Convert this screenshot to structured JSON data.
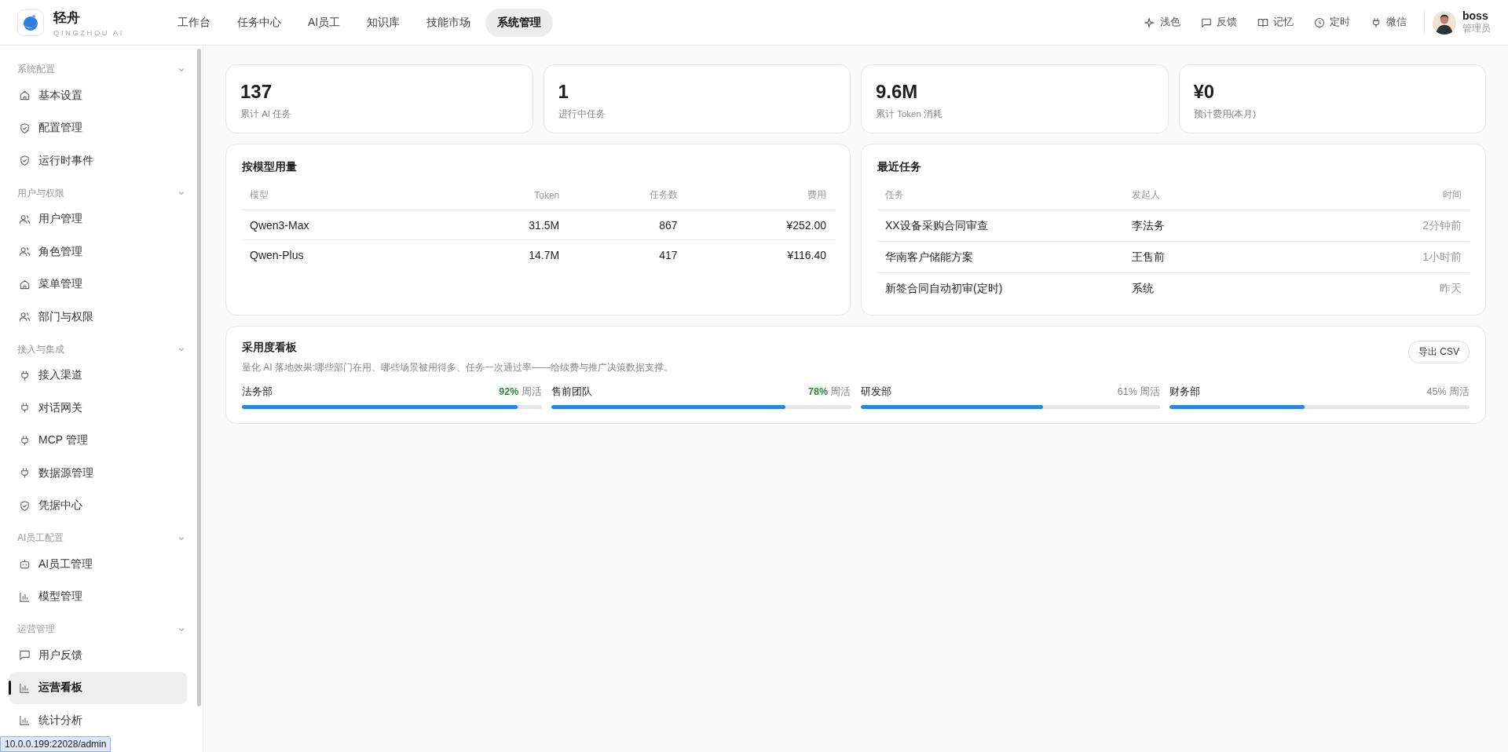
{
  "brand": {
    "name": "轻舟",
    "subtitle": "QINGZHOU AI"
  },
  "nav": [
    {
      "label": "工作台",
      "selected": false
    },
    {
      "label": "任务中心",
      "selected": false
    },
    {
      "label": "AI员工",
      "selected": false
    },
    {
      "label": "知识库",
      "selected": false
    },
    {
      "label": "技能市场",
      "selected": false
    },
    {
      "label": "系统管理",
      "selected": true
    }
  ],
  "actions": [
    {
      "kind": "sparkle",
      "label": "浅色"
    },
    {
      "kind": "chat",
      "label": "反馈"
    },
    {
      "kind": "book",
      "label": "记忆"
    },
    {
      "kind": "clock",
      "label": "定时"
    },
    {
      "kind": "plug",
      "label": "微信"
    }
  ],
  "user": {
    "name": "boss",
    "role": "管理员"
  },
  "sidebar": {
    "groups": [
      {
        "label": "系统配置",
        "expanded": true,
        "items": [
          {
            "kind": "home",
            "label": "基本设置",
            "selected": false
          },
          {
            "kind": "shield",
            "label": "配置管理",
            "selected": false
          },
          {
            "kind": "shield",
            "label": "运行时事件",
            "selected": false
          }
        ]
      },
      {
        "label": "用户与权限",
        "expanded": true,
        "items": [
          {
            "kind": "users",
            "label": "用户管理",
            "selected": false
          },
          {
            "kind": "users",
            "label": "角色管理",
            "selected": false
          },
          {
            "kind": "home",
            "label": "菜单管理",
            "selected": false
          },
          {
            "kind": "users",
            "label": "部门与权限",
            "selected": false
          }
        ]
      },
      {
        "label": "接入与集成",
        "expanded": true,
        "items": [
          {
            "kind": "plug",
            "label": "接入渠道",
            "selected": false
          },
          {
            "kind": "plug",
            "label": "对话网关",
            "selected": false
          },
          {
            "kind": "plug",
            "label": "MCP 管理",
            "selected": false
          },
          {
            "kind": "plug",
            "label": "数据源管理",
            "selected": false
          },
          {
            "kind": "shield",
            "label": "凭据中心",
            "selected": false
          }
        ]
      },
      {
        "label": "AI员工配置",
        "expanded": true,
        "items": [
          {
            "kind": "bot",
            "label": "AI员工管理",
            "selected": false
          },
          {
            "kind": "chart",
            "label": "模型管理",
            "selected": false
          }
        ]
      },
      {
        "label": "运营管理",
        "expanded": true,
        "items": [
          {
            "kind": "chat",
            "label": "用户反馈",
            "selected": false
          },
          {
            "kind": "chart",
            "label": "运营看板",
            "selected": true
          },
          {
            "kind": "chart",
            "label": "统计分析",
            "selected": false
          }
        ]
      }
    ]
  },
  "stats": [
    {
      "value": "137",
      "label": "累计 AI 任务"
    },
    {
      "value": "1",
      "label": "进行中任务"
    },
    {
      "value": "9.6M",
      "label": "累计 Token 消耗"
    },
    {
      "value": "¥0",
      "label": "预计费用(本月)"
    }
  ],
  "model_usage": {
    "title": "按模型用量",
    "columns": [
      "模型",
      "Token",
      "任务数",
      "费用"
    ],
    "rows": [
      [
        "Qwen3-Max",
        "31.5M",
        "867",
        "¥252.00"
      ],
      [
        "Qwen-Plus",
        "14.7M",
        "417",
        "¥116.40"
      ]
    ]
  },
  "recent_tasks": {
    "title": "最近任务",
    "columns": [
      "任务",
      "发起人",
      "时间"
    ],
    "rows": [
      [
        "XX设备采购合同审查",
        "李法务",
        "2分钟前"
      ],
      [
        "华南客户储能方案",
        "王售前",
        "1小时前"
      ],
      [
        "新签合同自动初审(定时)",
        "系统",
        "昨天"
      ]
    ]
  },
  "adoption": {
    "title": "采用度看板",
    "description": "量化 AI 落地效果:哪些部门在用、哪些场景被用得多、任务一次通过率——给续费与推广决策数据支撑。",
    "export_button": "导出 CSV",
    "departments": [
      {
        "name": "法务部",
        "percent": "92%",
        "suffix": "周活",
        "highlight": true,
        "level": 0.92
      },
      {
        "name": "售前团队",
        "percent": "78%",
        "suffix": "周活",
        "highlight": true,
        "level": 0.78
      },
      {
        "name": "研发部",
        "percent": "61%",
        "suffix": "周活",
        "highlight": false,
        "level": 0.61
      },
      {
        "name": "财务部",
        "percent": "45%",
        "suffix": "周活",
        "highlight": false,
        "level": 0.45
      }
    ]
  },
  "status_bar": {
    "url": "10.0.0.199:22028/admin"
  }
}
